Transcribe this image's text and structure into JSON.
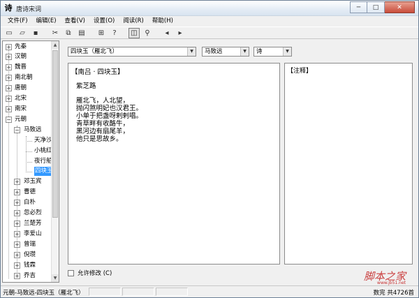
{
  "window": {
    "title": "唐诗宋词",
    "icon_glyph": "诗",
    "buttons": {
      "minimize": "─",
      "maximize": "□",
      "close": "✕"
    }
  },
  "menu": {
    "items": [
      {
        "label": "文件(F)"
      },
      {
        "label": "编辑(E)"
      },
      {
        "label": "查看(V)"
      },
      {
        "label": "设置(O)"
      },
      {
        "label": "阅读(R)"
      },
      {
        "label": "帮助(H)"
      }
    ]
  },
  "toolbar": {
    "icons": [
      {
        "name": "new-icon",
        "glyph": "▭"
      },
      {
        "name": "open-icon",
        "glyph": "▱"
      },
      {
        "name": "save-icon",
        "glyph": "▪"
      },
      {
        "name": "cut-icon",
        "glyph": "✂"
      },
      {
        "name": "copy-icon",
        "glyph": "⧉"
      },
      {
        "name": "paste-icon",
        "glyph": "▤"
      },
      {
        "name": "tree-icon",
        "glyph": "⊞"
      },
      {
        "name": "help-icon",
        "glyph": "?"
      },
      {
        "name": "read-icon",
        "glyph": "◫"
      },
      {
        "name": "find-icon",
        "glyph": "⚲"
      },
      {
        "name": "prev-icon",
        "glyph": "◂"
      },
      {
        "name": "next-icon",
        "glyph": "▸"
      }
    ]
  },
  "tree": {
    "nodes": [
      {
        "label": "先秦",
        "expander": "+"
      },
      {
        "label": "汉朝",
        "expander": "+"
      },
      {
        "label": "魏晋",
        "expander": "+"
      },
      {
        "label": "南北朝",
        "expander": "+"
      },
      {
        "label": "唐朝",
        "expander": "+"
      },
      {
        "label": "北宋",
        "expander": "+"
      },
      {
        "label": "南宋",
        "expander": "+"
      },
      {
        "label": "元朝",
        "expander": "−"
      },
      {
        "label": "马致远",
        "expander": "−"
      },
      {
        "label": "天净沙"
      },
      {
        "label": "小桃红"
      },
      {
        "label": "夜行船"
      },
      {
        "label": "四块玉",
        "selected": true
      },
      {
        "label": "邓玉宾",
        "expander": "+"
      },
      {
        "label": "曹德",
        "expander": "+"
      },
      {
        "label": "白朴",
        "expander": "+"
      },
      {
        "label": "忽必烈",
        "expander": "+"
      },
      {
        "label": "兰楚芳",
        "expander": "+"
      },
      {
        "label": "李爱山",
        "expander": "+"
      },
      {
        "label": "曾瑞",
        "expander": "+"
      },
      {
        "label": "倪瓒",
        "expander": "+"
      },
      {
        "label": "钱霖",
        "expander": "+"
      },
      {
        "label": "乔吉",
        "expander": "+"
      }
    ]
  },
  "selectors": {
    "poem_title": "四块玉（雁北飞）",
    "author": "马致远",
    "genre": "诗"
  },
  "poem": {
    "title": "【南吕 · 四块玉】",
    "subtitle": "紫芝路",
    "lines": [
      "雁北飞，人北望，",
      "抛闪煞明妃也汉君王。",
      "小单于把盏呀剌剌唱。",
      "青草畔有收酪牛，",
      "黑河边有扇尾羊，",
      "他只是思故乡。"
    ]
  },
  "notes": {
    "title": "【注释】"
  },
  "edit_toggle": {
    "label": "允许修改 (C)"
  },
  "status": {
    "path": "元朝-马致远-四块玉（雁北飞）",
    "right": "数完  共4726首"
  },
  "watermark": {
    "text": "脚本之家",
    "url": "www.jb51.net"
  }
}
